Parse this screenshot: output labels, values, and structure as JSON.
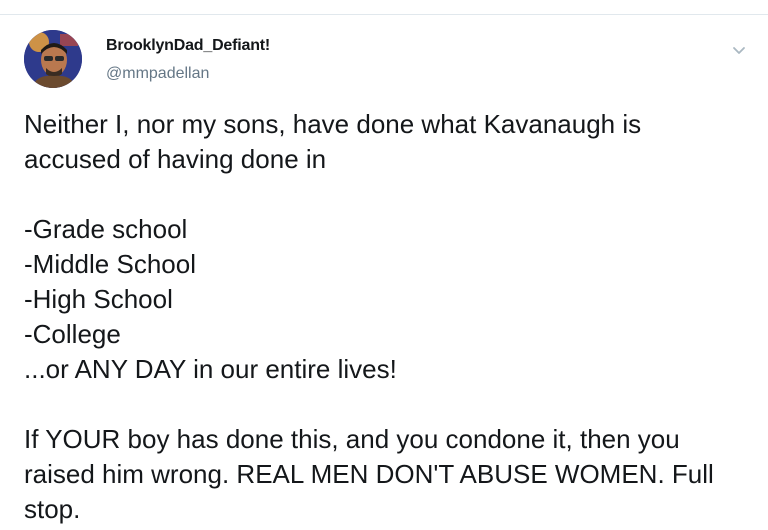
{
  "tweet": {
    "author": {
      "display_name": "BrooklynDad_Defiant!",
      "handle": "@mmpadellan",
      "avatar_icon": "avatar-photo"
    },
    "menu_icon": "chevron-down-icon",
    "lines": {
      "intro_1": "Neither I, nor my sons, have done what Kavanaugh is",
      "intro_2": "accused of having done in",
      "item_1": "-Grade school",
      "item_2": "-Middle School",
      "item_3": "-High School",
      "item_4": "-College",
      "closing_list": "...or ANY DAY in our entire lives!",
      "outro_1": "If YOUR boy has done this, and you condone it, then you",
      "outro_2": "raised him wrong. REAL MEN DON'T ABUSE WOMEN. Full",
      "outro_3": "stop."
    }
  },
  "colors": {
    "text": "#14171a",
    "secondary_text": "#657786",
    "divider": "#e1e8ed",
    "avatar_bg": "#3b3f8f"
  }
}
